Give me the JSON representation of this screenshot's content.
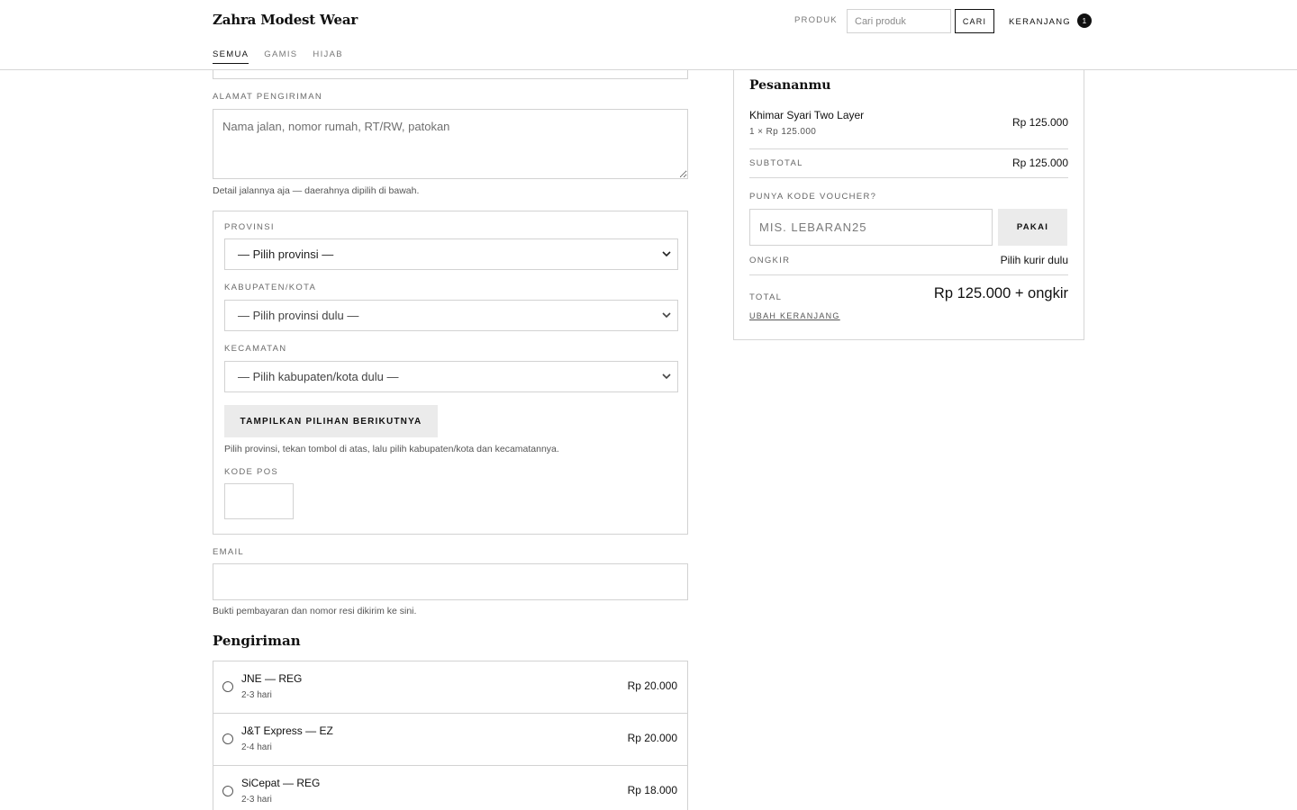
{
  "header": {
    "brand": "Zahra Modest Wear",
    "nav_produk": "PRODUK",
    "search_placeholder": "Cari produk",
    "search_button": "CARI",
    "cart_label": "KERANJANG",
    "cart_count": "1",
    "tabs": [
      {
        "label": "SEMUA",
        "active": true
      },
      {
        "label": "GAMIS",
        "active": false
      },
      {
        "label": "HIJAB",
        "active": false
      }
    ]
  },
  "form": {
    "address_label": "ALAMAT PENGIRIMAN",
    "address_placeholder": "Nama jalan, nomor rumah, RT/RW, patokan",
    "address_hint": "Detail jalannya aja — daerahnya dipilih di bawah.",
    "province_label": "PROVINSI",
    "province_value": "— Pilih provinsi —",
    "city_label": "KABUPATEN/KOTA",
    "city_value": "— Pilih provinsi dulu —",
    "district_label": "KECAMATAN",
    "district_value": "— Pilih kabupaten/kota dulu —",
    "next_button": "TAMPILKAN PILIHAN BERIKUTNYA",
    "region_hint": "Pilih provinsi, tekan tombol di atas, lalu pilih kabupaten/kota dan kecamatannya.",
    "zip_label": "KODE POS",
    "email_label": "EMAIL",
    "email_hint": "Bukti pembayaran dan nomor resi dikirim ke sini."
  },
  "shipping": {
    "heading": "Pengiriman",
    "options": [
      {
        "name": "JNE — REG",
        "eta": "2-3 hari",
        "price": "Rp 20.000"
      },
      {
        "name": "J&T Express — EZ",
        "eta": "2-4 hari",
        "price": "Rp 20.000"
      },
      {
        "name": "SiCepat — REG",
        "eta": "2-3 hari",
        "price": "Rp 18.000"
      }
    ]
  },
  "summary": {
    "title": "Pesananmu",
    "item_name": "Khimar Syari Two Layer",
    "item_qty": "1 × Rp 125.000",
    "item_price": "Rp 125.000",
    "subtotal_label": "SUBTOTAL",
    "subtotal_value": "Rp 125.000",
    "voucher_label": "PUNYA KODE VOUCHER?",
    "voucher_placeholder": "MIS. LEBARAN25",
    "voucher_button": "PAKAI",
    "shipping_label": "ONGKIR",
    "shipping_value": "Pilih kurir dulu",
    "total_label": "TOTAL",
    "total_value": "Rp 125.000 + ongkir",
    "edit_cart": "UBAH KERANJANG"
  }
}
